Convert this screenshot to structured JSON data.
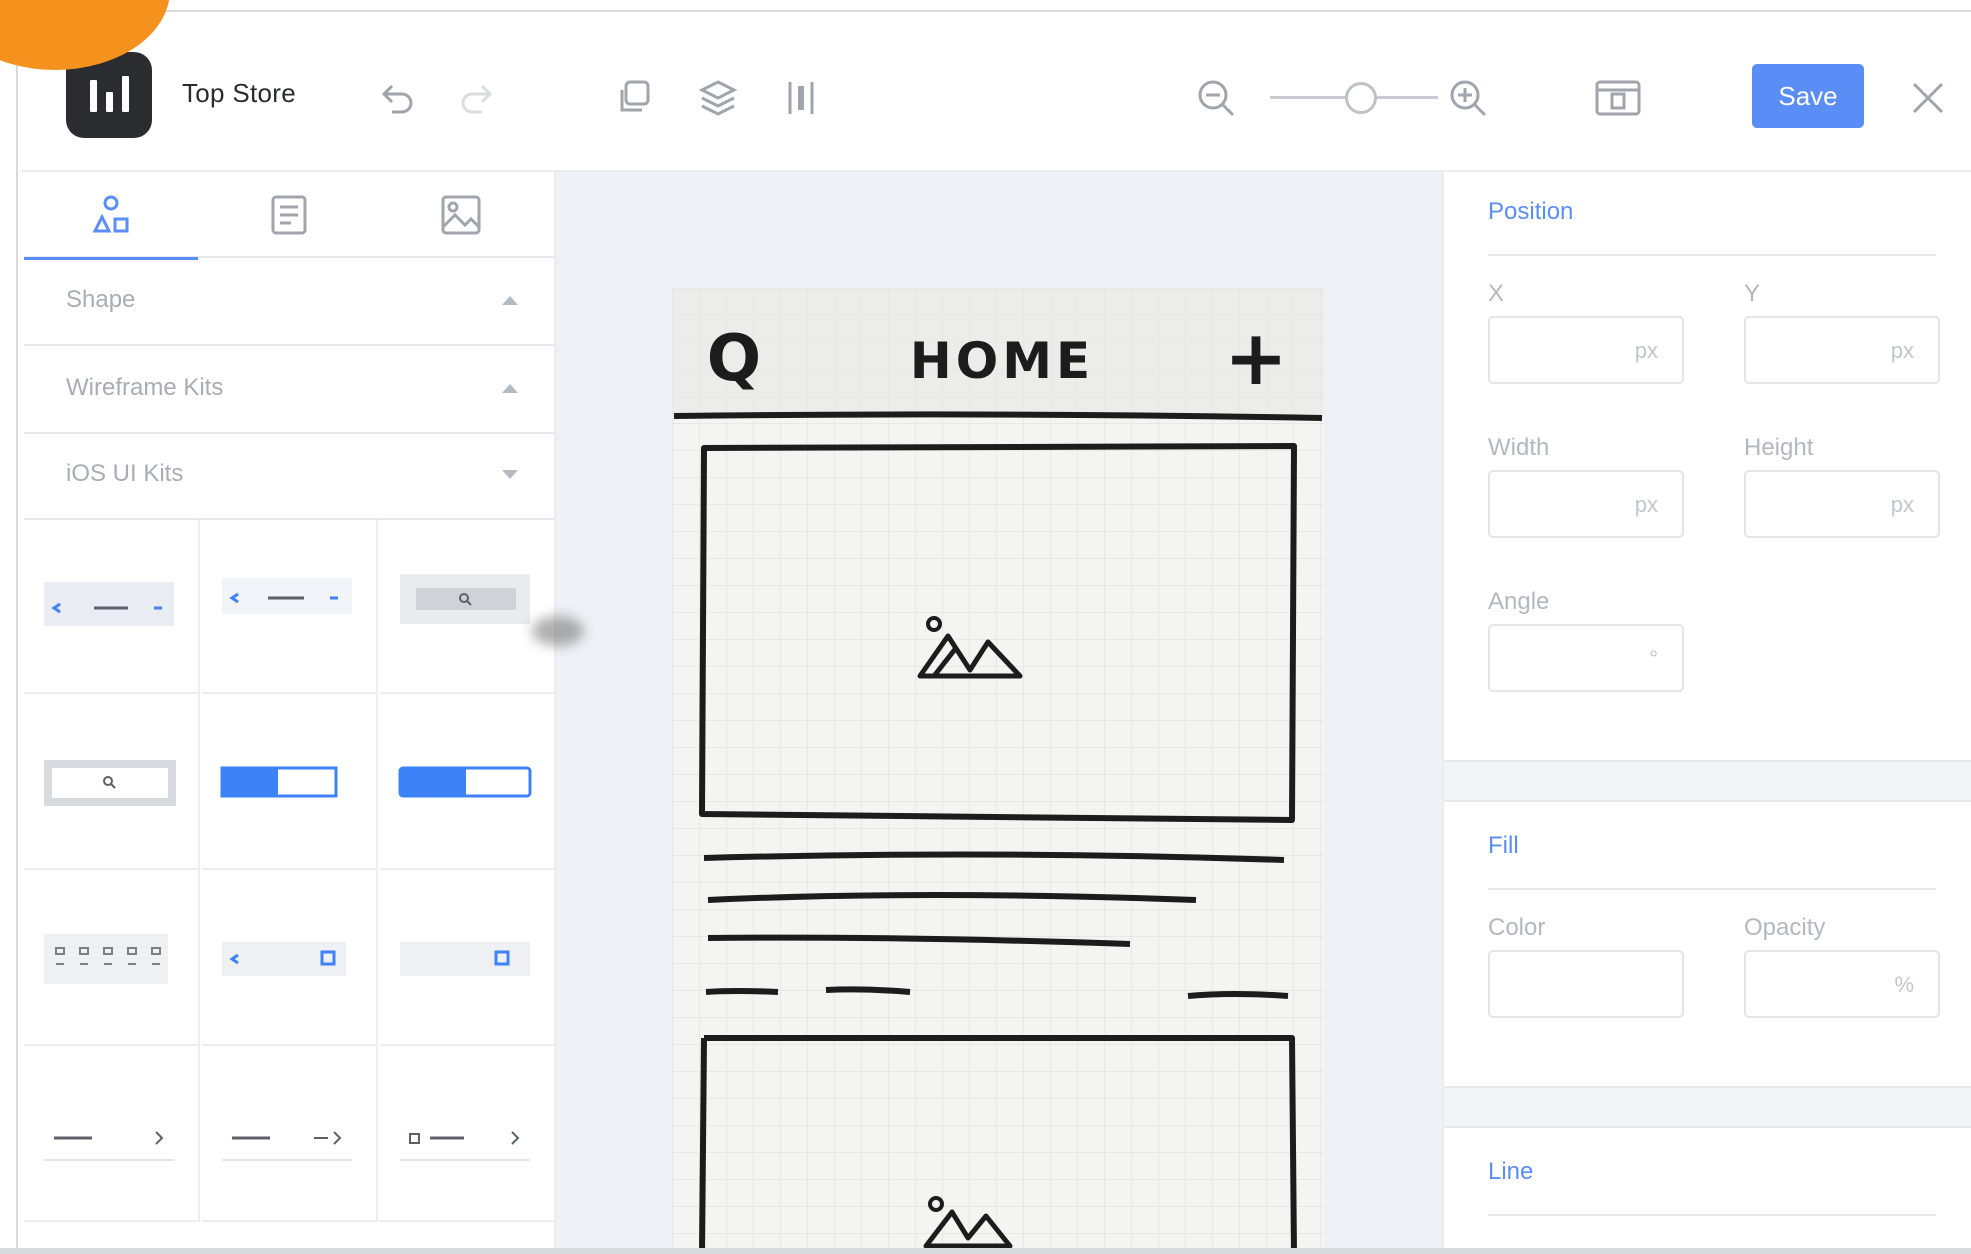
{
  "app": {
    "title": "Top Store",
    "save_label": "Save",
    "accent_color": "#5b8df6",
    "highlight_color": "#f5921e"
  },
  "toolbar": {
    "icons": [
      "undo-icon",
      "redo-icon",
      "duplicate-icon",
      "layers-icon",
      "align-icon",
      "zoom-out-icon",
      "zoom-in-icon",
      "preview-icon",
      "close-icon"
    ],
    "zoom_level": 0.5
  },
  "left_panel": {
    "tabs": [
      {
        "icon": "shapes-icon",
        "active": true
      },
      {
        "icon": "template-icon",
        "active": false
      },
      {
        "icon": "image-icon",
        "active": false
      }
    ],
    "sections": [
      {
        "label": "Shape",
        "expanded": true
      },
      {
        "label": "Wireframe Kits",
        "expanded": true
      },
      {
        "label": "iOS UI Kits",
        "expanded": false
      }
    ],
    "kit_items": [
      "nav-bar-back",
      "nav-bar-back-compact",
      "search-bar-filled",
      "search-bar-outlined",
      "segmented-toggle",
      "segmented-toggle-wide",
      "page-dots",
      "nav-bar-back-checkbox",
      "toolbar-checkbox",
      "list-row-chevron",
      "list-row-arrow",
      "list-row-checkbox-chevron"
    ]
  },
  "canvas": {
    "sketch": {
      "header_title": "HOME",
      "search_glyph": "Q",
      "add_glyph": "+"
    }
  },
  "right_panel": {
    "position": {
      "title": "Position",
      "x_label": "X",
      "x_value": "",
      "x_unit": "px",
      "y_label": "Y",
      "y_value": "",
      "y_unit": "px",
      "width_label": "Width",
      "width_value": "",
      "width_unit": "px",
      "height_label": "Height",
      "height_value": "",
      "height_unit": "px",
      "angle_label": "Angle",
      "angle_value": "",
      "angle_unit": "°"
    },
    "fill": {
      "title": "Fill",
      "color_label": "Color",
      "color_value": "",
      "opacity_label": "Opacity",
      "opacity_value": "",
      "opacity_unit": "%"
    },
    "line": {
      "title": "Line"
    }
  }
}
